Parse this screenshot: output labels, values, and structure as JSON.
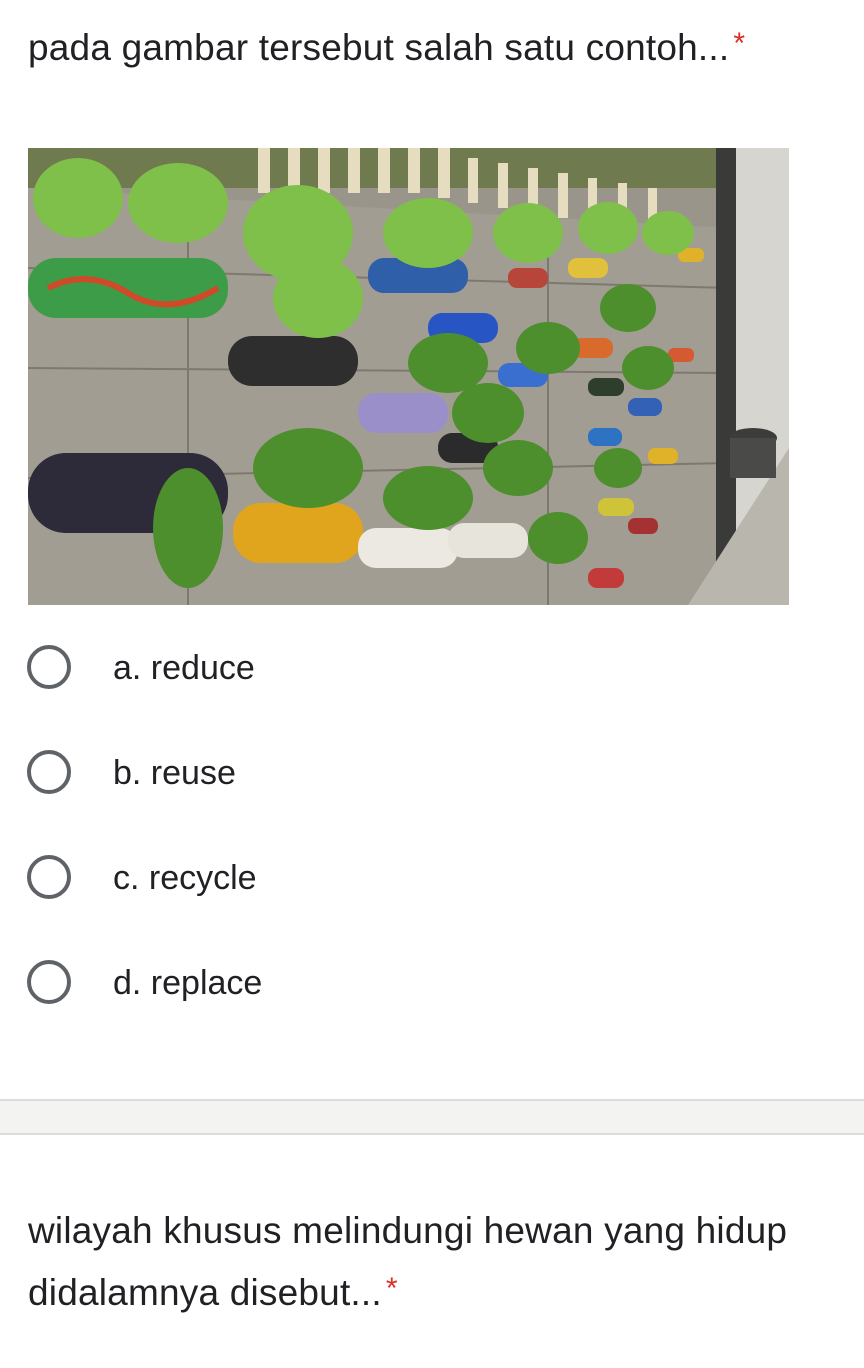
{
  "question1": {
    "title": "pada gambar tersebut salah satu contoh...",
    "required_mark": "*",
    "options": [
      {
        "label": "a. reduce"
      },
      {
        "label": "b. reuse"
      },
      {
        "label": "c. recycle"
      },
      {
        "label": "d. replace"
      }
    ]
  },
  "question2": {
    "title": "wilayah khusus melindungi hewan yang hidup didalamnya disebut...",
    "required_mark": "*"
  },
  "colors": {
    "required_star": "#d93025",
    "radio_border": "#5f6368",
    "text": "#202124",
    "divider_bg": "#f3f3f1"
  }
}
